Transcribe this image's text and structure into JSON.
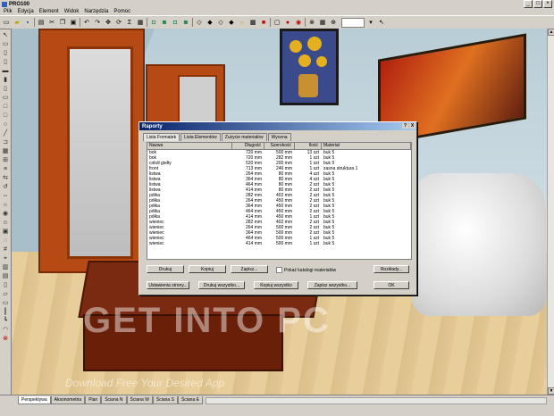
{
  "app": {
    "title": "PRO100"
  },
  "menu": [
    "Plik",
    "Edycja",
    "Element",
    "Widok",
    "Narzędzia",
    "Pomoc"
  ],
  "toolbar": {
    "icons": [
      "new-icon",
      "open-icon",
      "save-icon",
      "print-icon",
      "cut-icon",
      "copy-icon",
      "paste-icon",
      "undo-icon",
      "redo-icon",
      "move-icon",
      "rotate-icon",
      "sum-icon",
      "info-icon",
      "cube-icon",
      "view-icon",
      "view2-icon",
      "view3-icon",
      "light-icon",
      "render-icon",
      "stop-icon",
      "colors-icon",
      "settings-icon",
      "zoom-icon"
    ]
  },
  "watermark": {
    "main": "GET INTO PC",
    "sub": "Download Free Your Desired App"
  },
  "bottom_tabs": [
    "Perspektywa",
    "Aksonometria",
    "Plan",
    "Ściana N",
    "Ściana W",
    "Ściana S",
    "Ściana E"
  ],
  "dialog": {
    "title": "Raporty",
    "help_btn": "?",
    "close_btn": "X",
    "tabs": [
      "Lista Formatek",
      "Lista Elementów",
      "Zużycie materiałów",
      "Wycena"
    ],
    "columns": [
      "Nazwa",
      "Długość",
      "Szerokość",
      "Ilość",
      "Materiał"
    ],
    "rows": [
      [
        "bok",
        "720 mm",
        "500 mm",
        "13 szt",
        "buk 5"
      ],
      [
        "bok",
        "720 mm",
        "282 mm",
        "1 szt",
        "buk 5"
      ],
      [
        "cokół giełty",
        "520 mm",
        "200 mm",
        "1 szt",
        "buk 5"
      ],
      [
        "front",
        "713 mm",
        "246 mm",
        "1 szt",
        "zasna struktura 1"
      ],
      [
        "listwa",
        "264 mm",
        "80 mm",
        "4 szt",
        "buk 5"
      ],
      [
        "listwa",
        "364 mm",
        "80 mm",
        "4 szt",
        "buk 5"
      ],
      [
        "listwa",
        "464 mm",
        "80 mm",
        "2 szt",
        "buk 5"
      ],
      [
        "listwa",
        "414 mm",
        "80 mm",
        "2 szt",
        "buk 5"
      ],
      [
        "półka",
        "282 mm",
        "402 mm",
        "2 szt",
        "buk 5"
      ],
      [
        "półka",
        "264 mm",
        "450 mm",
        "2 szt",
        "buk 5"
      ],
      [
        "półka",
        "364 mm",
        "450 mm",
        "2 szt",
        "buk 5"
      ],
      [
        "półka",
        "464 mm",
        "450 mm",
        "2 szt",
        "buk 5"
      ],
      [
        "półka",
        "414 mm",
        "450 mm",
        "1 szt",
        "buk 5"
      ],
      [
        "wieniec",
        "282 mm",
        "402 mm",
        "2 szt",
        "buk 5"
      ],
      [
        "wieniec",
        "264 mm",
        "500 mm",
        "2 szt",
        "buk 5"
      ],
      [
        "wieniec",
        "364 mm",
        "500 mm",
        "2 szt",
        "buk 5"
      ],
      [
        "wieniec",
        "464 mm",
        "500 mm",
        "1 szt",
        "buk 5"
      ],
      [
        "wieniec",
        "414 mm",
        "500 mm",
        "1 szt",
        "buk 5"
      ]
    ],
    "buttons": {
      "drukuj": "Drukuj",
      "kopiuj": "Kopiuj",
      "zapisz": "Zapisz...",
      "pokaz_katalog": "Pokaż katalogi materiałów",
      "rozklady": "Rozkłady...",
      "ustawienia": "Ustawienia strony...",
      "drukuj_wszystko": "Drukuj wszystko...",
      "kopiuj_wszystko": "Kopiuj wszystko",
      "zapisz_wszystko": "Zapisz wszystko...",
      "ok": "OK"
    }
  }
}
